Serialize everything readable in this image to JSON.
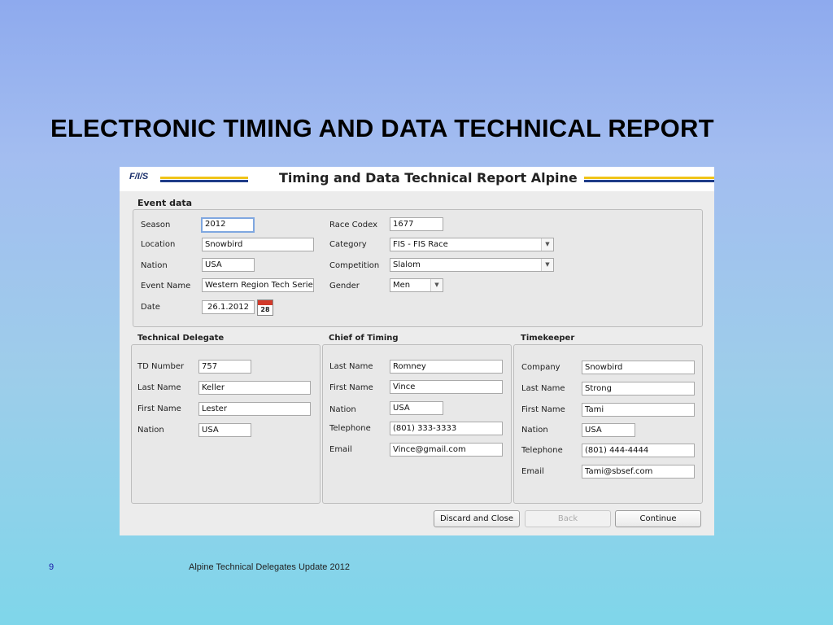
{
  "slide": {
    "title": "ELECTRONIC TIMING AND DATA TECHNICAL REPORT",
    "page_number": "9",
    "footer": "Alpine Technical Delegates Update 2012"
  },
  "dialog": {
    "logo": "F/I/S",
    "title": "Timing and Data Technical Report Alpine",
    "accent_colors": {
      "yellow": "#f0c419",
      "blue": "#1f3c88"
    }
  },
  "event": {
    "section_title": "Event data",
    "season_label": "Season",
    "season_value": "2012",
    "location_label": "Location",
    "location_value": "Snowbird",
    "nation_label": "Nation",
    "nation_value": "USA",
    "event_name_label": "Event Name",
    "event_name_value": "Western Region Tech Series",
    "date_label": "Date",
    "date_value": "26.1.2012",
    "calendar_day": "28",
    "race_codex_label": "Race Codex",
    "race_codex_value": "1677",
    "category_label": "Category",
    "category_value": "FIS - FIS Race",
    "competition_label": "Competition",
    "competition_value": "Slalom",
    "gender_label": "Gender",
    "gender_value": "Men"
  },
  "td": {
    "section_title": "Technical Delegate",
    "td_number_label": "TD Number",
    "td_number_value": "757",
    "last_name_label": "Last Name",
    "last_name_value": "Keller",
    "first_name_label": "First Name",
    "first_name_value": "Lester",
    "nation_label": "Nation",
    "nation_value": "USA"
  },
  "chief": {
    "section_title": "Chief of Timing",
    "last_name_label": "Last Name",
    "last_name_value": "Romney",
    "first_name_label": "First Name",
    "first_name_value": "Vince",
    "nation_label": "Nation",
    "nation_value": "USA",
    "telephone_label": "Telephone",
    "telephone_value": "(801) 333-3333",
    "email_label": "Email",
    "email_value": "Vince@gmail.com"
  },
  "timekeeper": {
    "section_title": "Timekeeper",
    "company_label": "Company",
    "company_value": "Snowbird",
    "last_name_label": "Last Name",
    "last_name_value": "Strong",
    "first_name_label": "First Name",
    "first_name_value": "Tami",
    "nation_label": "Nation",
    "nation_value": "USA",
    "telephone_label": "Telephone",
    "telephone_value": "(801) 444-4444",
    "email_label": "Email",
    "email_value": "Tami@sbsef.com"
  },
  "buttons": {
    "discard": "Discard and Close",
    "back": "Back",
    "continue": "Continue"
  }
}
